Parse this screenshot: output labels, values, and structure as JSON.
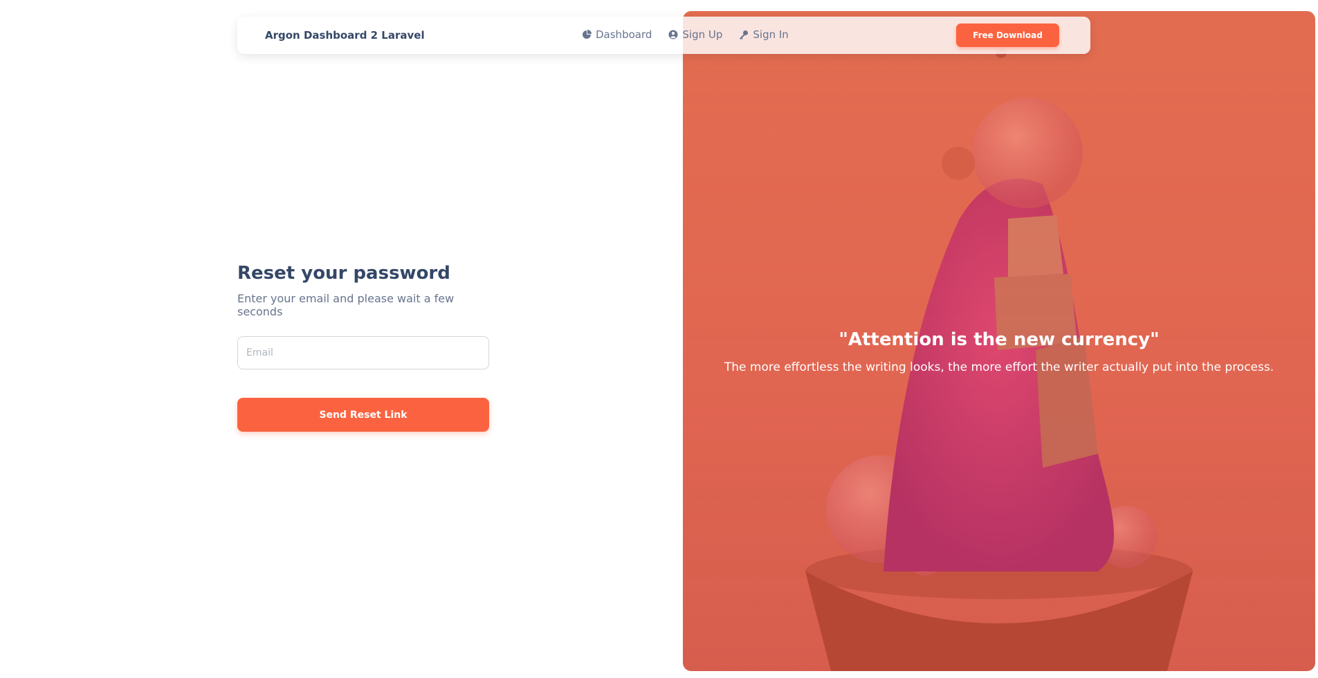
{
  "navbar": {
    "brand": "Argon Dashboard 2 Laravel",
    "links": [
      {
        "label": "Dashboard",
        "icon": "pie-chart-icon"
      },
      {
        "label": "Sign Up",
        "icon": "user-circle-icon"
      },
      {
        "label": "Sign In",
        "icon": "key-icon"
      }
    ],
    "download_label": "Free Download"
  },
  "form": {
    "title": "Reset your password",
    "subtitle": "Enter your email and please wait a few seconds",
    "email_placeholder": "Email",
    "email_value": "",
    "submit_label": "Send Reset Link"
  },
  "hero": {
    "quote": "\"Attention is the new currency\"",
    "subtext": "The more effortless the writing looks, the more effort the writer actually put into the process."
  },
  "colors": {
    "accent": "#fb6340",
    "text_dark": "#344767",
    "text_muted": "#67748e"
  }
}
